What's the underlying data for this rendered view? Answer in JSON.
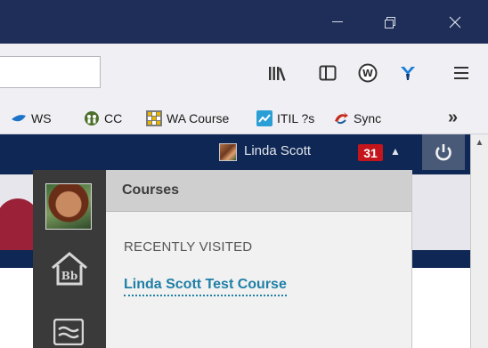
{
  "browser": {
    "titlebar_color": "#1e2e58",
    "window_controls": [
      "minimize-icon",
      "restore-icon",
      "close-icon"
    ],
    "toolbar_icons": [
      "library-icon",
      "sidebar-icon",
      "w-plugin-icon",
      "y-extension-icon",
      "hamburger-menu-icon"
    ],
    "bookmarks": [
      {
        "label": "WS",
        "icon": "blue-swoosh-icon"
      },
      {
        "label": "CC",
        "icon": "people-circle-icon"
      },
      {
        "label": "WA Course",
        "icon": "grid-icon"
      },
      {
        "label": "ITIL ?s",
        "icon": "chart-icon"
      },
      {
        "label": "Sync",
        "icon": "sync-arrow-icon"
      }
    ],
    "bookmarks_overflow": "»"
  },
  "user_bar": {
    "name": "Linda Scott",
    "notifications": "31",
    "badge_color": "#c4151c"
  },
  "courses_panel": {
    "title": "Courses",
    "recent_label": "RECENTLY VISITED",
    "recent_course": "Linda Scott Test Course",
    "link_color": "#1f7fa6"
  },
  "left_rail": {
    "items": [
      "avatar",
      "blackboard-home-icon",
      "tools-icon"
    ]
  }
}
